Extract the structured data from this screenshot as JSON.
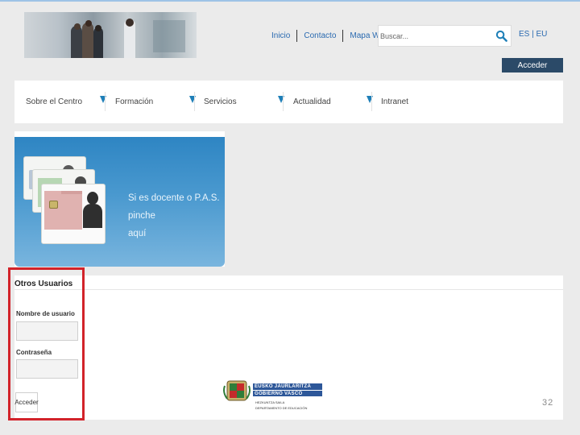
{
  "header": {
    "links": [
      {
        "label": "Inicio"
      },
      {
        "label": "Contacto"
      },
      {
        "label": "Mapa Web"
      }
    ],
    "search_placeholder": "Buscar...",
    "lang": "ES | EU",
    "acceder_label": "Acceder"
  },
  "nav": {
    "items": [
      {
        "label": "Sobre el Centro"
      },
      {
        "label": "Formación"
      },
      {
        "label": "Servicios"
      },
      {
        "label": "Actualidad"
      },
      {
        "label": "Intranet"
      }
    ],
    "arrow_color": "#1e7fb8"
  },
  "banner": {
    "line1": "Si es docente o P.A.S. pinche",
    "line2": "aquí"
  },
  "login": {
    "title": "Otros Usuarios",
    "username_label": "Nombre de usuario",
    "password_label": "Contraseña",
    "submit_label": "Acceder"
  },
  "footer": {
    "logo_line1": "EUSKO JAURLARITZA",
    "logo_line2": "GOBIERNO VASCO",
    "logo_sub1": "HEZKUNTZA SAILA",
    "logo_sub2": "DEPARTAMENTO DE EDUCACIÓN",
    "page_number": "32"
  },
  "colors": {
    "link": "#2a6ab0",
    "acceder_bg": "#2b4a68",
    "highlight_frame": "#d2232a",
    "banner_blue": "#2e85c3"
  }
}
